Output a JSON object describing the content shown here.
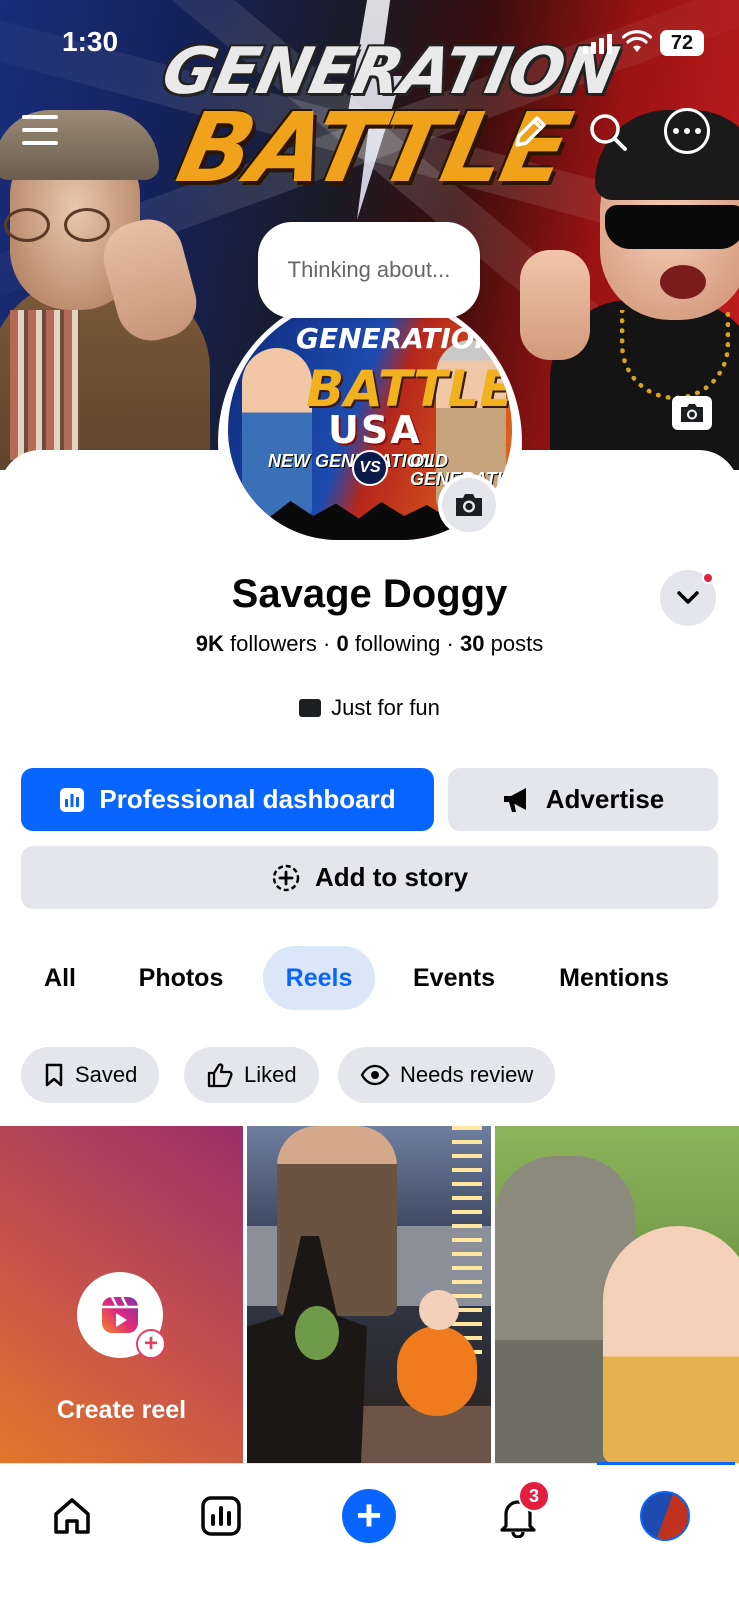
{
  "status_bar": {
    "time": "1:30",
    "battery": "72"
  },
  "cover": {
    "title_line1": "GENERATION",
    "title_line2": "BATTLE"
  },
  "avatar": {
    "line1": "GENERATION",
    "line2": "BATTLE",
    "line3": "USA",
    "left_label": "NEW GENERATION",
    "vs": "VS",
    "right_label": "OLD GENERATION"
  },
  "thinking_bubble": {
    "placeholder": "Thinking about..."
  },
  "profile": {
    "name": "Savage Doggy",
    "followers": "9K",
    "followers_label": "followers",
    "following": "0",
    "following_label": "following",
    "posts": "30",
    "posts_label": "posts",
    "separator": "·",
    "bio": "Just for fun"
  },
  "actions": {
    "dashboard": "Professional dashboard",
    "advertise": "Advertise",
    "add_story": "Add to story"
  },
  "tabs": [
    {
      "label": "All",
      "active": false
    },
    {
      "label": "Photos",
      "active": false
    },
    {
      "label": "Reels",
      "active": true
    },
    {
      "label": "Events",
      "active": false
    },
    {
      "label": "Mentions",
      "active": false
    }
  ],
  "filters": [
    {
      "label": "Saved",
      "icon": "bookmark-icon"
    },
    {
      "label": "Liked",
      "icon": "thumbs-up-icon"
    },
    {
      "label": "Needs review",
      "icon": "eye-icon"
    }
  ],
  "reels": {
    "create_label": "Create reel"
  },
  "nav": {
    "items": [
      "home-icon",
      "insights-icon",
      "create-plus-icon",
      "notifications-icon",
      "profile-avatar"
    ],
    "plus": "+",
    "notifications_badge": "3"
  },
  "colors": {
    "accent": "#0866ff",
    "badge": "#e41e3f",
    "chip_bg": "#e4e6eb",
    "active_tab_bg": "#dbe7f8"
  }
}
